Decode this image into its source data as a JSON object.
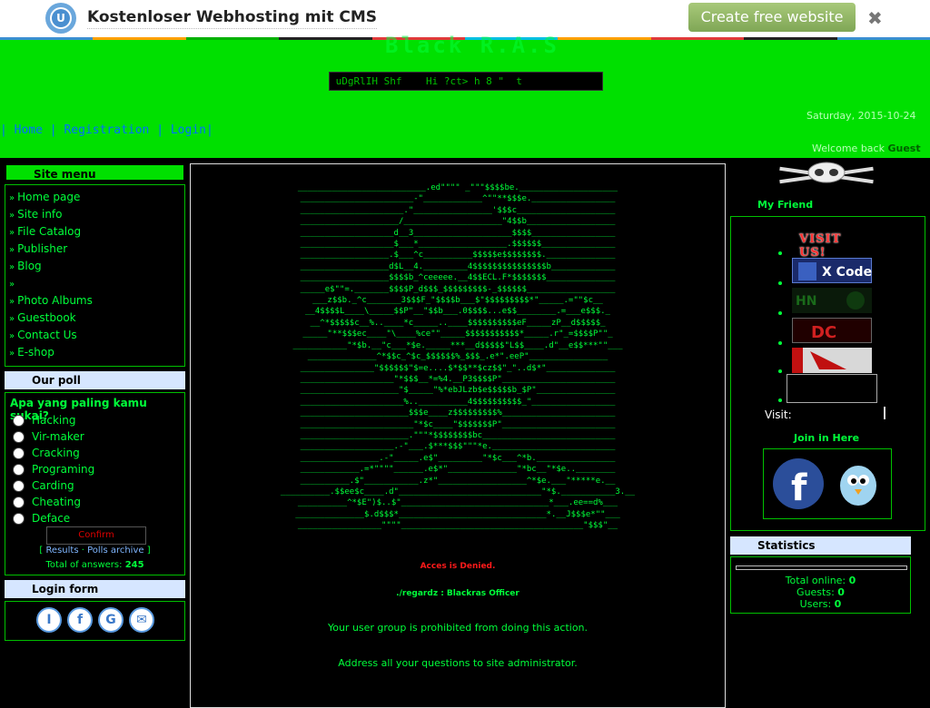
{
  "topbar": {
    "title": "Kostenloser Webhosting mit CMS",
    "cta": "Create free website",
    "close": "✖",
    "logo_letter": "U"
  },
  "header": {
    "site_name": "Black R.A.S",
    "marquee": " uDgRlIH Shf    Hi ?ct> h 8 \"  t",
    "nav": [
      "Home",
      "Registration",
      "Login"
    ],
    "date": "Saturday, 2015-10-24",
    "welcome": "Welcome back",
    "user": "Guest"
  },
  "site_menu": {
    "title": "Site menu",
    "items": [
      "Home page",
      "Site info",
      "File Catalog",
      "Publisher",
      "Blog",
      "",
      "Photo Albums",
      "Guestbook",
      "Contact Us",
      "E-shop"
    ]
  },
  "poll": {
    "title": "Our poll",
    "question": "Apa yang paling kamu sukai?",
    "options": [
      "Hacking",
      "Vir-maker",
      "Cracking",
      "Programing",
      "Carding",
      "Cheating",
      "Deface"
    ],
    "confirm": "Confirm",
    "results": "Results",
    "archive": "Polls archive",
    "total_label": "Total of answers:",
    "total": "245"
  },
  "login": {
    "title": "Login form"
  },
  "main": {
    "denied": "Acces is Denied.",
    "regardz": "./regardz : Blackras Officer",
    "message1": "Your user group is prohibited from doing this action.",
    "message2": "Address all your questions to site administrator."
  },
  "friends": {
    "title": "My Friend",
    "visit_us": "VISIT US!",
    "visit_label": "Visit:",
    "join": "Join in Here"
  },
  "stats": {
    "title": "Statistics",
    "online_label": "Total online:",
    "online": "0",
    "guests_label": "Guests:",
    "guests": "0",
    "users_label": "Users:",
    "users": "0"
  },
  "colors": {
    "accent": "#00e000",
    "text_green": "#00ff3a",
    "link_blue": "#0070ff",
    "panel_head": "#d6e6ff"
  }
}
